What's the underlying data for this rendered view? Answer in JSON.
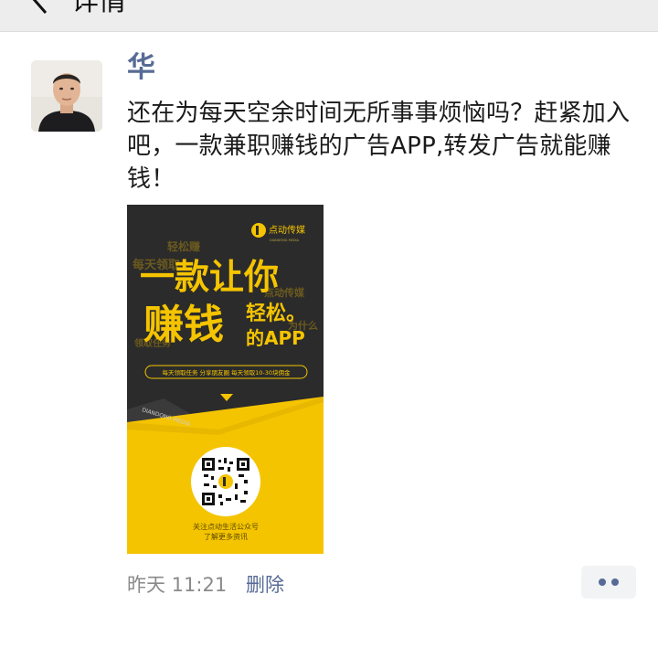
{
  "header": {
    "back_icon": "chevron-left-icon",
    "title": "详情"
  },
  "post": {
    "author": "华",
    "text": "还在为每天空余时间无所事事烦恼吗？赶紧加入吧，一款兼职赚钱的广告APP,转发广告就能赚钱！",
    "time": "昨天 11:21",
    "delete_label": "删除",
    "more_icon": "more-dots-icon"
  },
  "poster": {
    "logo_text": "点动传媒",
    "logo_sub": "DIANDONG MEDIA",
    "headline_1": "一款让你",
    "headline_2": "赚钱",
    "headline_3a": "轻松。",
    "headline_3b": "的APP",
    "bg_words": [
      "轻松赚",
      "每天领取",
      "点动传媒",
      "为什么",
      "领取任务"
    ],
    "features": "每天领取任务  分享朋友圈  每天领取10-30块佣金",
    "band_text": "DIANDONG MEDIA",
    "qr_caption_1": "关注点动生活公众号",
    "qr_caption_2": "了解更多资讯",
    "accent_color": "#f5c400",
    "dark_color": "#2b2b2b"
  }
}
